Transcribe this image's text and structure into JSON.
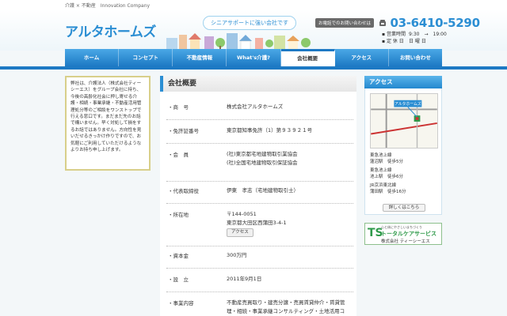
{
  "header": {
    "tagline": "介護 × 不動産　Innovation Company",
    "logo": "アルタホームズ",
    "badge": "シニアサポートに強い会社です",
    "phone_label": "お電話でのお問い合わせは",
    "phone_number": "03-6410-5290",
    "hours": [
      {
        "key": "営業時間",
        "value": "9:30　→　19:00"
      },
      {
        "key": "定 休 日",
        "value": "日 曜 日"
      }
    ]
  },
  "nav": {
    "tabs": [
      "ホーム",
      "コンセプト",
      "不動産情報",
      "What's介護?",
      "会社概要",
      "アクセス",
      "お問い合わせ"
    ],
    "active": 4
  },
  "intro": "弊社は、介護法人（株式会社ティーシーエス）をグループ会社に持ち、今後の高齢化社会に押し寄せる介護・相続・事業承継・不動産活用管理処分等のご相談をワンストップで行える窓口です。まだまだ先のお話で構いません。早く対処して損をするお話ではありません。方向性を見いだせるきっかけ作りですので、お気軽にご利用していただけるようなよりお持ち申し上げます。",
  "company": {
    "title": "会社概要",
    "rows": [
      {
        "label": "・商　号",
        "value": "株式会社アルタホームズ"
      },
      {
        "label": "・免許証番号",
        "value": "東京都知事免許（1）第９３９２１号"
      },
      {
        "label": "・会　員",
        "value": "(社)東京都宅地建物取引業協会\n(社)全国宅地建物取引保証協会"
      },
      {
        "label": "・代表取締役",
        "value": "伊東　孝志（宅地建物取引士）"
      },
      {
        "label": "・所在地",
        "value": "〒144-0051\n東京都大田区西蒲田3-4-1",
        "button": "アクセス"
      },
      {
        "label": "・資本金",
        "value": "300万円"
      },
      {
        "label": "・設　立",
        "value": "2011年9月1日"
      },
      {
        "label": "・事業内容",
        "value": "不動産売買取り・建売分譲・売買賃貸仲介・賃貸管理・相続・事業承継コンサルティング・土地活用コ"
      }
    ]
  },
  "access": {
    "title": "アクセス",
    "map_label": "アルタホームズ",
    "stations": [
      {
        "line": "東急池上線",
        "name": "蓮沼駅　徒歩5分"
      },
      {
        "line": "東急池上線",
        "name": "池上駅　徒歩6分"
      },
      {
        "line": "JR京浜東北線",
        "name": "蒲田駅　徒歩16分"
      }
    ],
    "detail_button": "詳しくはこちら"
  },
  "banner": {
    "mark": "TS",
    "line1": "心と体にやさしいまちづくり",
    "line2": "トータルケアサービス",
    "line3": "株式会社 ティーシーエス"
  },
  "colors": {
    "accent": "#2b8ed3",
    "nav": "#1d79c4",
    "green": "#2f9a4a"
  }
}
